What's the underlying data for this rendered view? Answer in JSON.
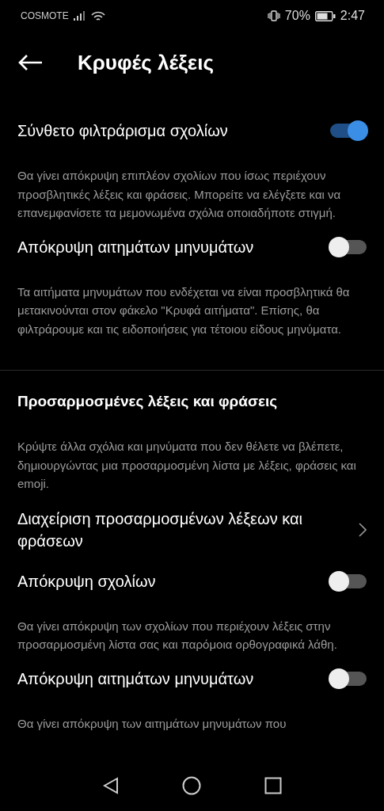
{
  "status_bar": {
    "carrier": "COSMOTE",
    "battery": "70%",
    "time": "2:47"
  },
  "header": {
    "title": "Κρυφές λέξεις"
  },
  "items": [
    {
      "kind": "toggle",
      "label": "Σύνθετο φιλτράρισμα σχολίων",
      "on": true,
      "description": "Θα γίνει απόκρυψη επιπλέον σχολίων που ίσως περιέχουν προσβλητικές λέξεις και φράσεις. Μπορείτε να ελέγξετε και να επανεμφανίσετε τα μεμονωμένα σχόλια οποιαδήποτε στιγμή."
    },
    {
      "kind": "toggle",
      "label": "Απόκρυψη αιτημάτων μηνυμάτων",
      "on": false,
      "description": "Τα αιτήματα μηνυμάτων που ενδέχεται να είναι προσβλητικά θα μετακινούνται στον φάκελο \"Κρυφά αιτήματα\". Επίσης, θα φιλτράρουμε και τις ειδοποιήσεις για τέτοιου είδους μηνύματα."
    },
    {
      "kind": "header",
      "label": "Προσαρμοσμένες λέξεις και φράσεις",
      "description": "Κρύψτε άλλα σχόλια και μηνύματα που δεν θέλετε να βλέπετε, δημιουργώντας μια προσαρμοσμένη λίστα με λέξεις, φράσεις και emoji."
    },
    {
      "kind": "link",
      "label": "Διαχείριση προσαρμοσμένων λέξεων και φράσεων"
    },
    {
      "kind": "toggle",
      "label": "Απόκρυψη σχολίων",
      "on": false,
      "description": "Θα γίνει απόκρυψη των σχολίων που περιέχουν λέξεις στην προσαρμοσμένη λίστα σας και παρόμοια ορθογραφικά λάθη."
    },
    {
      "kind": "toggle",
      "label": "Απόκρυψη αιτημάτων μηνυμάτων",
      "on": false,
      "description": "Θα γίνει απόκρυψη των αιτημάτων μηνυμάτων που"
    }
  ]
}
